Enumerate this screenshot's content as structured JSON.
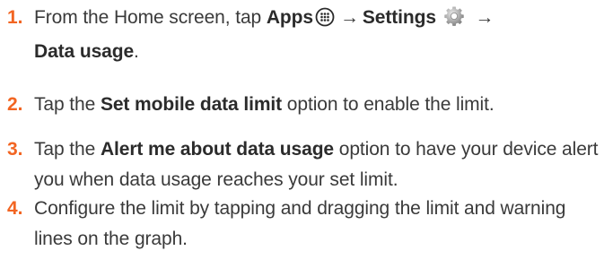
{
  "steps": [
    {
      "number": "1.",
      "pre": "From the Home screen, tap",
      "apps": "Apps",
      "arrow1": "→",
      "settings": "Settings",
      "arrow2": "→",
      "data_usage": "Data usage",
      "end": ".",
      "icons": [
        "apps-grid-icon",
        "settings-gear-icon"
      ]
    },
    {
      "number": "2.",
      "pre": "Tap the",
      "bold": "Set mobile data limit",
      "post": "option to enable the limit."
    },
    {
      "number": "3.",
      "pre": "Tap the",
      "bold": "Alert me about data usage",
      "post": "option to have your device alert you when data usage reaches your set limit."
    },
    {
      "number": "4.",
      "text": "Configure the limit by tapping and dragging the limit and warning lines on the graph."
    }
  ],
  "colors": {
    "step_number": "#f26522",
    "text": "#3a3a3a"
  }
}
